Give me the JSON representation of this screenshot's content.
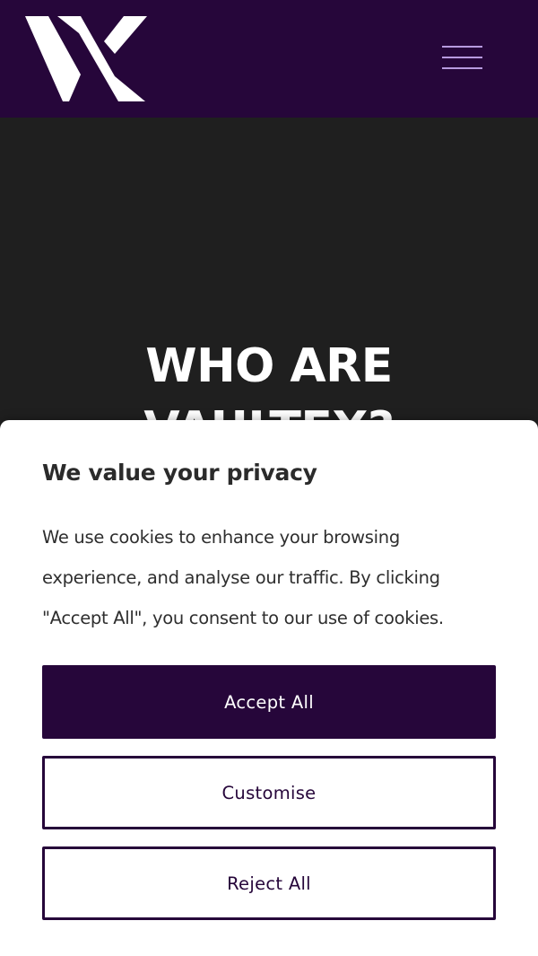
{
  "colors": {
    "brand": "#26063a",
    "hero_background": "#1f1f1f",
    "menu_lines": "#b79adf",
    "panel_background": "#ffffff"
  },
  "header": {
    "logo_icon": "vx-logo-icon",
    "menu_icon": "hamburger-menu-icon"
  },
  "hero": {
    "title_line1": "WHO ARE",
    "title_line2": "VAULTEX?"
  },
  "cookie_banner": {
    "title": "We value your privacy",
    "body": "We use cookies to enhance your browsing experience, and analyse our traffic. By clicking \"Accept All\", you consent to our use of cookies.",
    "accept_label": "Accept All",
    "customise_label": "Customise",
    "reject_label": "Reject All"
  }
}
